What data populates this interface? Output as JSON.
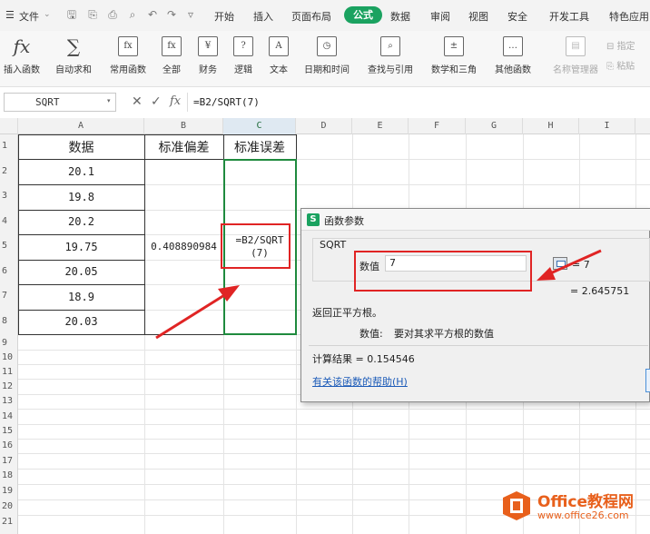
{
  "menubar": {
    "file_label": "文件",
    "tabs": [
      "开始",
      "插入",
      "页面布局",
      "公式",
      "数据",
      "审阅",
      "视图",
      "安全",
      "开发工具",
      "特色应用"
    ],
    "active_tab": "公式"
  },
  "ribbon": {
    "buttons": [
      "插入函数",
      "自动求和",
      "常用函数",
      "全部",
      "财务",
      "逻辑",
      "文本",
      "日期和时间",
      "查找与引用",
      "数学和三角",
      "其他函数",
      "名称管理器"
    ],
    "side_buttons": [
      "指定",
      "粘贴"
    ]
  },
  "formula_bar": {
    "name_box": "SQRT",
    "fx": "fx",
    "formula": "=B2/SQRT(7)"
  },
  "grid": {
    "columns": [
      "A",
      "B",
      "C",
      "D",
      "E",
      "F",
      "G",
      "H",
      "I"
    ],
    "rows": [
      "1",
      "2",
      "3",
      "4",
      "5",
      "6",
      "7",
      "8",
      "9",
      "10",
      "11",
      "12",
      "13",
      "14",
      "15",
      "16",
      "17",
      "18",
      "19",
      "20",
      "21"
    ],
    "headers": {
      "a1": "数据",
      "b1": "标准偏差",
      "c1": "标准误差"
    },
    "data_values": [
      "20.1",
      "19.8",
      "20.2",
      "19.75",
      "20.05",
      "18.9",
      "20.03"
    ],
    "b_value": "0.408890984",
    "c_formula_line1": "=B2/SQRT",
    "c_formula_line2": "(7)"
  },
  "dialog": {
    "title": "函数参数",
    "function_name": "SQRT",
    "param_label": "数值",
    "param_value": "7",
    "param_result": "= 7",
    "result_right": "= 2.645751",
    "description": "返回正平方根。",
    "param_desc_label": "数值:",
    "param_desc": "要对其求平方根的数值",
    "calc_result": "计算结果 = 0.154546",
    "help_link": "有关该函数的帮助(H)"
  },
  "watermark": {
    "title": "Office教程网",
    "url": "www.office26.com"
  },
  "colors": {
    "accent_green": "#1aa260",
    "highlight_red": "#e02424",
    "watermark_orange": "#e8601c"
  }
}
